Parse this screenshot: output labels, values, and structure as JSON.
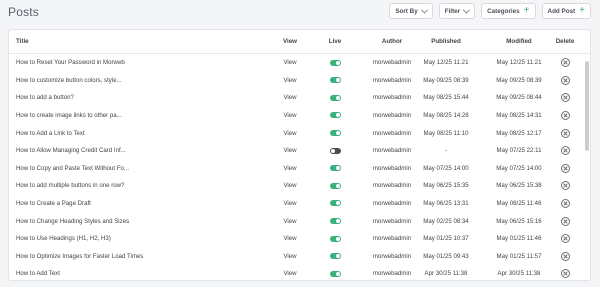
{
  "page": {
    "title": "Posts"
  },
  "toolbar": {
    "sort_label": "Sort By",
    "filter_label": "Filter",
    "categories_label": "Categories",
    "add_post_label": "Add Post"
  },
  "table": {
    "headers": {
      "title": "Title",
      "view": "View",
      "live": "Live",
      "author": "Author",
      "published": "Published",
      "modified": "Modified",
      "delete": "Delete"
    },
    "rows": [
      {
        "title": "How to Reset Your Password in Morweb",
        "view": "View",
        "live": true,
        "author": "morwebadmin",
        "published": "May 12/25 11:21",
        "modified": "May 12/25 11:21"
      },
      {
        "title": "How to customize button colors, style...",
        "view": "View",
        "live": true,
        "author": "morwebadmin",
        "published": "May 09/25 08:39",
        "modified": "May 09/25 08:39"
      },
      {
        "title": "How to add a button?",
        "view": "View",
        "live": true,
        "author": "morwebadmin",
        "published": "May 08/25 15:44",
        "modified": "May 09/25 08:44"
      },
      {
        "title": "How to create image links to other pa...",
        "view": "View",
        "live": true,
        "author": "morwebadmin",
        "published": "May 08/25 14:28",
        "modified": "May 08/25 14:31"
      },
      {
        "title": "How to Add a Link to Text",
        "view": "View",
        "live": true,
        "author": "morwebadmin",
        "published": "May 08/25 11:10",
        "modified": "May 08/25 12:17"
      },
      {
        "title": "How to Allow Managing Credit Card Inf...",
        "view": "View",
        "live": false,
        "author": "morwebadmin",
        "published": "-",
        "modified": "May 07/25 22:11"
      },
      {
        "title": "How to Copy and Paste Text Without Fo...",
        "view": "View",
        "live": true,
        "author": "morwebadmin",
        "published": "May 07/25 14:00",
        "modified": "May 07/25 14:00"
      },
      {
        "title": "How to add multiple buttons in one row?",
        "view": "View",
        "live": true,
        "author": "morwebadmin",
        "published": "May 06/25 15:35",
        "modified": "May 06/25 15:38"
      },
      {
        "title": "How to Create a Page Draft",
        "view": "View",
        "live": true,
        "author": "morwebadmin",
        "published": "May 06/25 13:31",
        "modified": "May 08/25 11:46"
      },
      {
        "title": "How to Change Heading Styles and Sizes",
        "view": "View",
        "live": true,
        "author": "morwebadmin",
        "published": "May 02/25 08:34",
        "modified": "May 06/25 15:16"
      },
      {
        "title": "How to Use Headings (H1, H2, H3)",
        "view": "View",
        "live": true,
        "author": "morwebadmin",
        "published": "May 01/25 10:37",
        "modified": "May 01/25 11:46"
      },
      {
        "title": "How to Optimize Images for Faster Load Times",
        "view": "View",
        "live": true,
        "author": "morwebadmin",
        "published": "May 01/25 09:43",
        "modified": "May 01/25 11:57"
      },
      {
        "title": "How to Add Text",
        "view": "View",
        "live": true,
        "author": "morwebadmin",
        "published": "Apr 30/25 11:38",
        "modified": "Apr 30/25 11:38"
      }
    ]
  },
  "colors": {
    "accent": "#3bb07a",
    "toggle_off": "#4a4f55"
  },
  "icons": {
    "sort": "chevron-down-icon",
    "filter": "chevron-down-icon",
    "categories": "plus-icon",
    "add_post": "plus-icon",
    "delete": "circle-x-icon"
  }
}
